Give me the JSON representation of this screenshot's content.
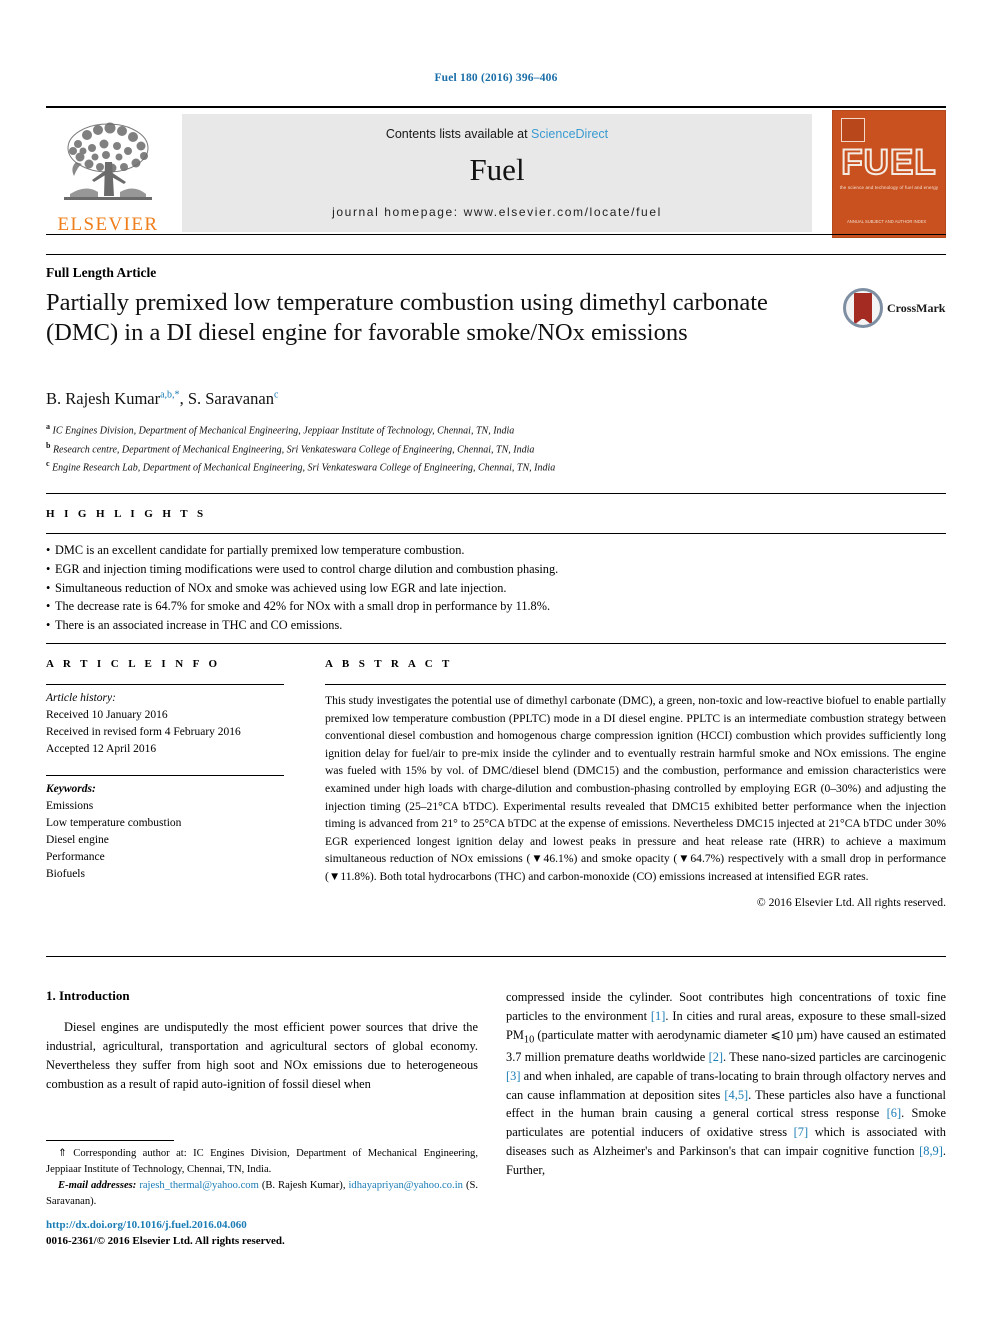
{
  "running_head": "Fuel 180 (2016) 396–406",
  "masthead": {
    "publisher_name": "ELSEVIER",
    "contents_prefix": "Contents lists available at ",
    "contents_link": "ScienceDirect",
    "journal_title": "Fuel",
    "homepage": "journal homepage: www.elsevier.com/locate/fuel",
    "cover": {
      "title": "FUEL",
      "subtitle": "the science and technology of fuel and energy",
      "footer": "ANNUAL SUBJECT AND\nAUTHOR INDEX"
    },
    "accent_color": "#ef7d1a",
    "link_color": "#3a9bd1",
    "cover_color": "#c9511f"
  },
  "article": {
    "type": "Full Length Article",
    "title": "Partially premixed low temperature combustion using dimethyl carbonate (DMC) in a DI diesel engine for favorable smoke/NOx emissions",
    "authors": [
      {
        "name": "B. Rajesh Kumar",
        "marks": "a,b,*"
      },
      {
        "name": "S. Saravanan",
        "marks": "c"
      }
    ],
    "affiliations": [
      {
        "mark": "a",
        "text": "IC Engines Division, Department of Mechanical Engineering, Jeppiaar Institute of Technology, Chennai, TN, India"
      },
      {
        "mark": "b",
        "text": "Research centre, Department of Mechanical Engineering, Sri Venkateswara College of Engineering, Chennai, TN, India"
      },
      {
        "mark": "c",
        "text": "Engine Research Lab, Department of Mechanical Engineering, Sri Venkateswara College of Engineering, Chennai, TN, India"
      }
    ],
    "crossmark_label": "CrossMark"
  },
  "highlights": {
    "heading": "H I G H L I G H T S",
    "items": [
      "DMC is an excellent candidate for partially premixed low temperature combustion.",
      "EGR and injection timing modifications were used to control charge dilution and combustion phasing.",
      "Simultaneous reduction of NOx and smoke was achieved using low EGR and late injection.",
      "The decrease rate is 64.7% for smoke and 42% for NOx with a small drop in performance by 11.8%.",
      "There is an associated increase in THC and CO emissions."
    ]
  },
  "article_info": {
    "heading": "A R T I C L E  I N F O",
    "history_label": "Article history:",
    "history": [
      "Received 10 January 2016",
      "Received in revised form 4 February 2016",
      "Accepted 12 April 2016"
    ],
    "keywords_label": "Keywords:",
    "keywords": [
      "Emissions",
      "Low temperature combustion",
      "Diesel engine",
      "Performance",
      "Biofuels"
    ]
  },
  "abstract": {
    "heading": "A B S T R A C T",
    "text": "This study investigates the potential use of dimethyl carbonate (DMC), a green, non-toxic and low-reactive biofuel to enable partially premixed low temperature combustion (PPLTC) mode in a DI diesel engine. PPLTC is an intermediate combustion strategy between conventional diesel combustion and homogenous charge compression ignition (HCCI) combustion which provides sufficiently long ignition delay for fuel/air to pre-mix inside the cylinder and to eventually restrain harmful smoke and NOx emissions. The engine was fueled with 15% by vol. of DMC/diesel blend (DMC15) and the combustion, performance and emission characteristics were examined under high loads with charge-dilution and combustion-phasing controlled by employing EGR (0–30%) and adjusting the injection timing (25–21°CA bTDC). Experimental results revealed that DMC15 exhibited better performance when the injection timing is advanced from 21° to 25°CA bTDC at the expense of emissions. Nevertheless DMC15 injected at 21°CA bTDC under 30% EGR experienced longest ignition delay and lowest peaks in pressure and heat release rate (HRR) to achieve a maximum simultaneous reduction of NOx emissions (▼46.1%) and smoke opacity (▼64.7%) respectively with a small drop in performance (▼11.8%). Both total hydrocarbons (THC) and carbon-monoxide (CO) emissions increased at intensified EGR rates.",
    "copyright": "© 2016 Elsevier Ltd. All rights reserved."
  },
  "introduction": {
    "heading": "1. Introduction",
    "left_paragraph": "Diesel engines are undisputedly the most efficient power sources that drive the industrial, agricultural, transportation and agricultural sectors of global economy. Nevertheless they suffer from high soot and NOx emissions due to heterogeneous combustion as a result of rapid auto-ignition of fossil diesel when",
    "right_paragraph": "compressed inside the cylinder. Soot contributes high concentrations of toxic fine particles to the environment [1]. In cities and rural areas, exposure to these small-sized PM10 (particulate matter with aerodynamic diameter ⩽10 µm) have caused an estimated 3.7 million premature deaths worldwide [2]. These nano-sized particles are carcinogenic [3] and when inhaled, are capable of trans-locating to brain through olfactory nerves and can cause inflammation at deposition sites [4,5]. These particles also have a functional effect in the human brain causing a general cortical stress response [6]. Smoke particulates are potential inducers of oxidative stress [7] which is associated with diseases such as Alzheimer's and Parkinson's that can impair cognitive function [8,9]. Further,"
  },
  "footnotes": {
    "corresponding": "⇑ Corresponding author at: IC Engines Division, Department of Mechanical Engineering, Jeppiaar Institute of Technology, Chennai, TN, India.",
    "email_label": "E-mail addresses:",
    "email_1": "rajesh_thermal@yahoo.com",
    "email_1_owner": "(B. Rajesh Kumar)",
    "email_2": "idhayapriyan@yahoo.co.in",
    "email_2_owner": "(S. Saravanan)."
  },
  "footer": {
    "doi": "http://dx.doi.org/10.1016/j.fuel.2016.04.060",
    "issn": "0016-2361/© 2016 Elsevier Ltd. All rights reserved."
  }
}
